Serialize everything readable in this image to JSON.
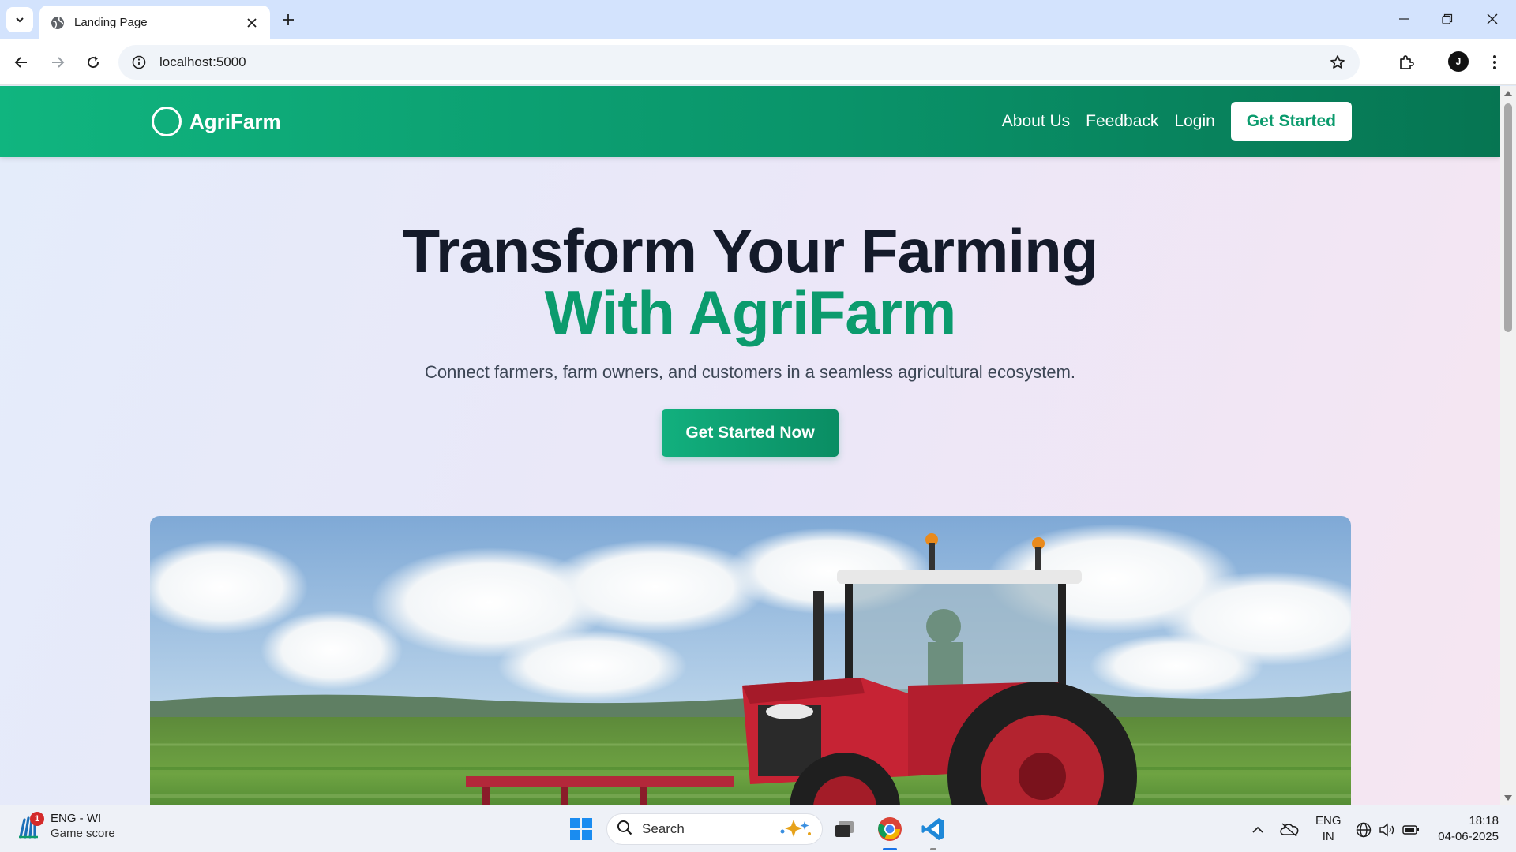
{
  "browser": {
    "tab_title": "Landing Page",
    "url": "localhost:5000",
    "profile_initials": "J"
  },
  "site": {
    "brand": "AgriFarm",
    "nav": [
      "About Us",
      "Feedback",
      "Login"
    ],
    "nav_cta": "Get Started",
    "hero": {
      "title_line1": "Transform Your Farming",
      "title_line2": "With AgriFarm",
      "subtitle": "Connect farmers, farm owners, and customers in a seamless agricultural ecosystem.",
      "cta": "Get Started Now"
    },
    "colors": {
      "brand_green": "#0b9b6d",
      "heading_dark": "#141a2a"
    }
  },
  "taskbar": {
    "widget_title": "ENG - WI",
    "widget_subtitle": "Game score",
    "widget_badge": "1",
    "search_label": "Search",
    "lang_line1": "ENG",
    "lang_line2": "IN",
    "time": "18:18",
    "date": "04-06-2025"
  }
}
